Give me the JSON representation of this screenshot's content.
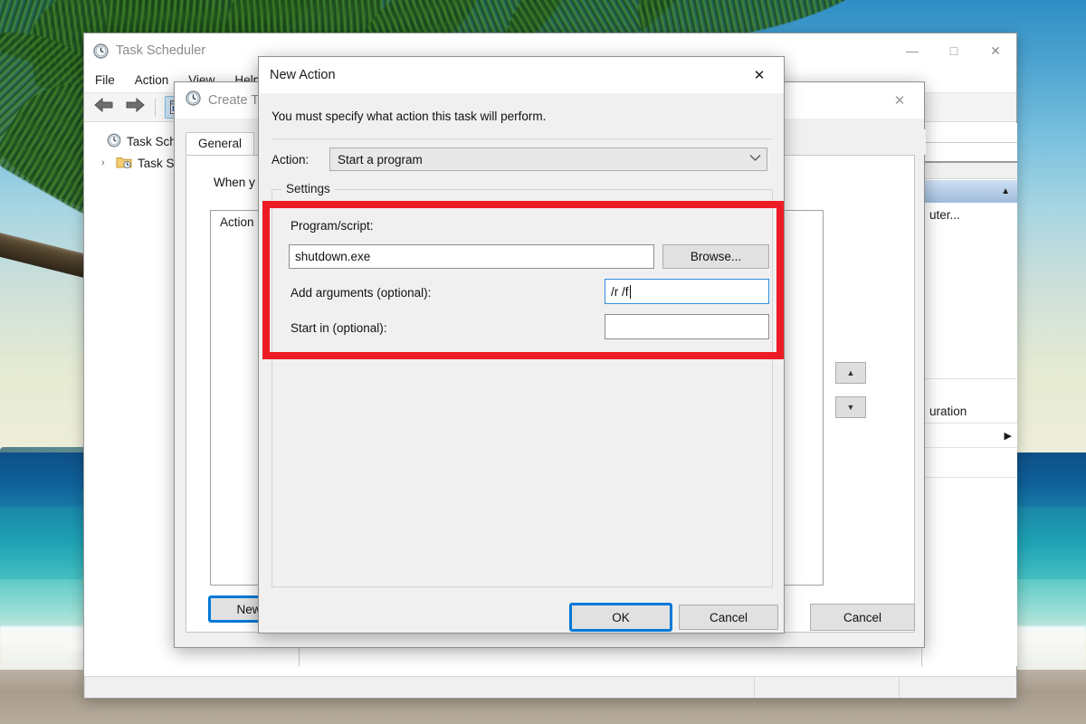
{
  "desktop": {
    "wallpaper_description": "tropical beach with palm fronds"
  },
  "task_scheduler": {
    "title": "Task Scheduler",
    "icon": "clock-icon",
    "menu": [
      "File",
      "Action",
      "View",
      "Help"
    ],
    "window_buttons": {
      "minimize": "—",
      "maximize": "□",
      "close": "✕"
    },
    "toolbar": {
      "back": "⬅",
      "forward": "➡",
      "properties_icon": "window-list-icon"
    },
    "tree": [
      {
        "label": "Task Sche",
        "icon": "clock-icon",
        "chevron": ""
      },
      {
        "label": "Task S",
        "icon": "folder-clock-icon",
        "chevron": "›"
      }
    ]
  },
  "create_task": {
    "title": "Create T",
    "icon": "clock-icon",
    "close": "✕",
    "tabs": [
      "General"
    ],
    "description": "When y",
    "list_header": "Action",
    "new_button": "New",
    "cancel_button": "Cancel"
  },
  "new_action": {
    "title": "New Action",
    "close": "✕",
    "instruction": "You must specify what action this task will perform.",
    "action_label": "Action:",
    "action_value": "Start a program",
    "action_arrow": "⌄",
    "settings_group": "Settings",
    "program_label": "Program/script:",
    "program_value": "shutdown.exe",
    "browse_button": "Browse...",
    "arguments_label": "Add arguments (optional):",
    "arguments_value": "/r /f",
    "arguments_placeholder": "",
    "start_in_label": "Start in (optional):",
    "start_in_value": "",
    "start_in_placeholder": "",
    "ok_button": "OK",
    "cancel_button": "Cancel"
  },
  "actions_pane": {
    "header_collapse": "▲",
    "items": [
      {
        "label": "uter...",
        "submenu": ""
      },
      {
        "label": "uration",
        "submenu": ""
      },
      {
        "label": "",
        "submenu": "▶"
      }
    ]
  },
  "annotation": {
    "highlight_color": "#ed1c24",
    "target": "settings-fields-region"
  }
}
